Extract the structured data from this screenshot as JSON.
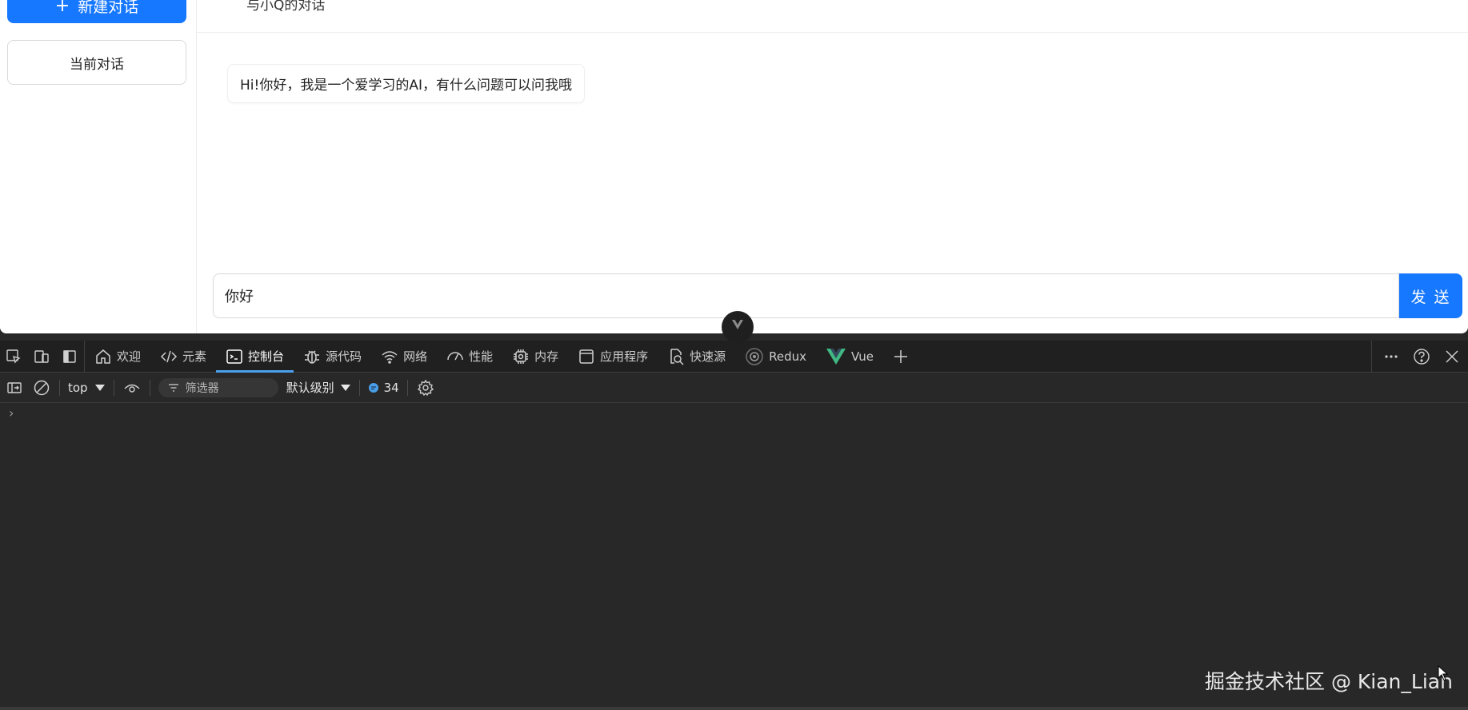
{
  "app": {
    "sidebar": {
      "new_chat_label": "新建对话",
      "current_chat_label": "当前对话"
    },
    "header": {
      "title": "与小Q的对话"
    },
    "messages": [
      {
        "text": "Hi!你好，我是一个爱学习的AI，有什么问题可以问我哦"
      }
    ],
    "input": {
      "value": "你好"
    },
    "send_label": "发 送",
    "accent_color": "#1677ff"
  },
  "devtools": {
    "tabs": [
      {
        "label": "欢迎",
        "icon": "home-icon"
      },
      {
        "label": "元素",
        "icon": "code-icon"
      },
      {
        "label": "控制台",
        "icon": "console-icon",
        "active": true
      },
      {
        "label": "源代码",
        "icon": "bug-icon"
      },
      {
        "label": "网络",
        "icon": "wifi-icon"
      },
      {
        "label": "性能",
        "icon": "gauge-icon"
      },
      {
        "label": "内存",
        "icon": "chip-icon"
      },
      {
        "label": "应用程序",
        "icon": "window-icon"
      },
      {
        "label": "快速源",
        "icon": "search-file-icon"
      },
      {
        "label": "Redux",
        "icon": "redux-icon"
      },
      {
        "label": "Vue",
        "icon": "vue-icon"
      }
    ],
    "toolbar": {
      "context": "top",
      "filter_placeholder": "筛选器",
      "level": "默认级别",
      "message_count": "34"
    },
    "prompt": "›"
  },
  "watermark": "掘金技术社区 @ Kian_Lian"
}
